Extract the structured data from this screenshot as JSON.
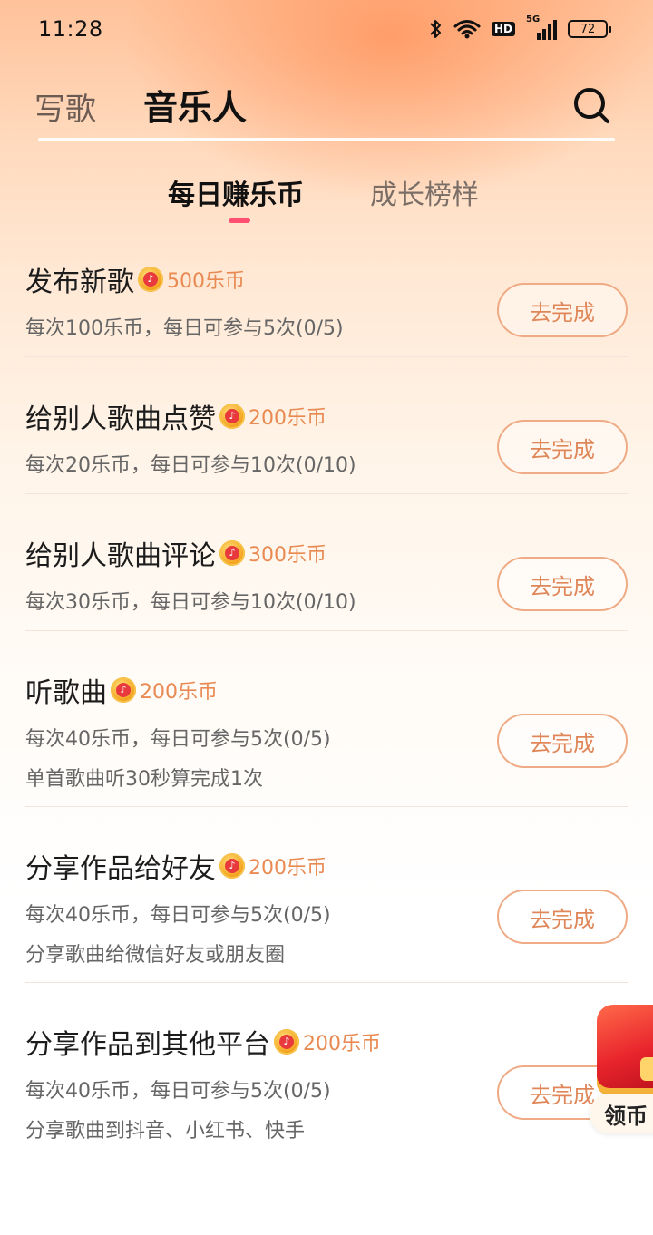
{
  "status_bar": {
    "time": "11:28",
    "hd": "HD",
    "network": "5G",
    "battery": "72"
  },
  "header": {
    "tab_write": "写歌",
    "tab_musician": "音乐人"
  },
  "subtabs": {
    "daily": "每日赚乐币",
    "growth": "成长榜样"
  },
  "tasks": [
    {
      "title": "发布新歌",
      "reward": "500乐币",
      "desc": "每次100乐币，每日可参与5次(0/5)",
      "extra": "",
      "button": "去完成"
    },
    {
      "title": "给别人歌曲点赞",
      "reward": "200乐币",
      "desc": "每次20乐币，每日可参与10次(0/10)",
      "extra": "",
      "button": "去完成"
    },
    {
      "title": "给别人歌曲评论",
      "reward": "300乐币",
      "desc": "每次30乐币，每日可参与10次(0/10)",
      "extra": "",
      "button": "去完成"
    },
    {
      "title": "听歌曲",
      "reward": "200乐币",
      "desc": "每次40乐币，每日可参与5次(0/5)",
      "extra": "单首歌曲听30秒算完成1次",
      "button": "去完成"
    },
    {
      "title": "分享作品给好友",
      "reward": "200乐币",
      "desc": "每次40乐币，每日可参与5次(0/5)",
      "extra": "分享歌曲给微信好友或朋友圈",
      "button": "去完成"
    },
    {
      "title": "分享作品到其他平台",
      "reward": "200乐币",
      "desc": "每次40乐币，每日可参与5次(0/5)",
      "extra": "分享歌曲到抖音、小红书、快手",
      "button": "去完成"
    }
  ],
  "floating_widget": {
    "label": "领币"
  },
  "colors": {
    "accent_orange": "#e0875a",
    "tab_indicator": "#ff4f72"
  }
}
